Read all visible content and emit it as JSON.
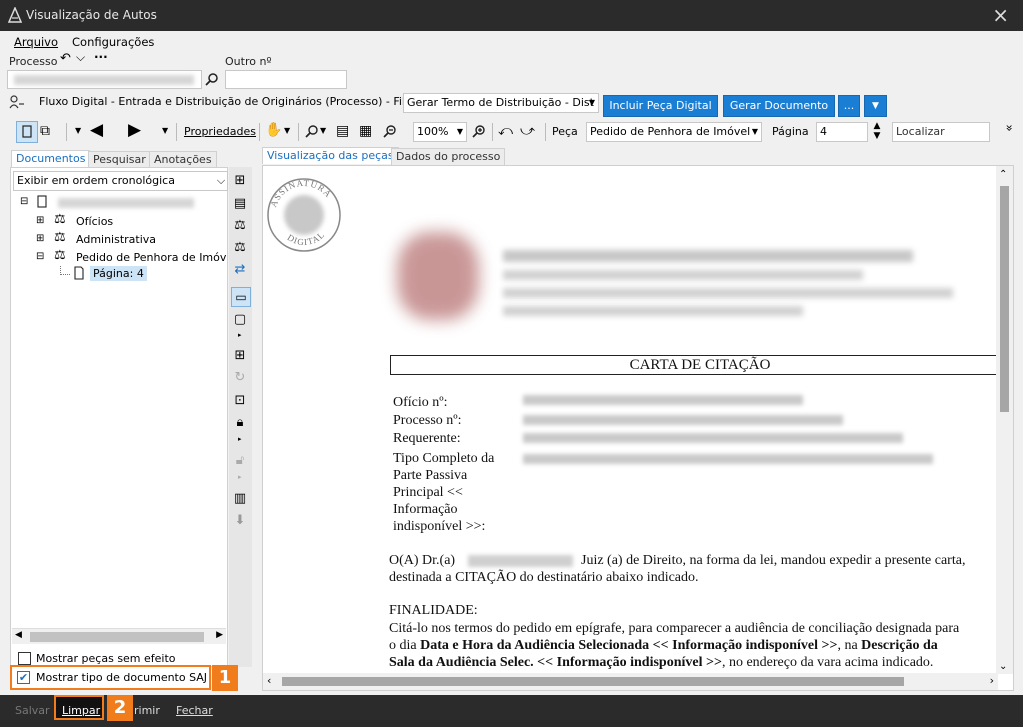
{
  "window": {
    "title": "Visualização de Autos",
    "close_icon": "×"
  },
  "menu": {
    "arquivo": "Arquivo",
    "configuracoes": "Configurações"
  },
  "process": {
    "label": "Processo",
    "other_label": "Outro nº",
    "undo_icon": "↶",
    "dropdown_icon": "⌵",
    "more_icon": "···"
  },
  "fluxo": {
    "text": "Fluxo Digital - Entrada e Distribuição de Originários (Processo) - Fila:",
    "fila_value": "Gerar Termo de Distribuição - Dist",
    "incluir_btn": "Incluir Peça Digital",
    "gerar_btn": "Gerar Documento",
    "more_btn": "...",
    "menu_btn": "▼"
  },
  "toolbar": {
    "propriedades": "Propriedades",
    "zoom": "100%",
    "peca_label": "Peça",
    "peca_value": "Pedido de Penhora de Imóvel",
    "pagina_label": "Página",
    "pagina_value": "4",
    "localizar": "Localizar",
    "overflow_icon": "»"
  },
  "left_panel": {
    "tabs": [
      "Documentos",
      "Pesquisar",
      "Anotações"
    ],
    "order": "Exibir em ordem cronológica",
    "tree": {
      "items": [
        "Ofícios",
        "Administrativa",
        "Pedido de Penhora de Imóvel"
      ],
      "page": "Página: 4"
    },
    "checkbox1": "Mostrar peças sem efeito",
    "checkbox2": "Mostrar tipo de documento SAJ"
  },
  "right_panel": {
    "tabs": [
      "Visualização das peças",
      "Dados do processo"
    ]
  },
  "document": {
    "stamp_top": "ASSINATURA",
    "stamp_bottom": "DIGITAL",
    "heading": "CARTA DE CITAÇÃO",
    "fields": [
      "Ofício nº:",
      "Processo nº:",
      "Requerente:",
      "Tipo Completo da",
      "Parte Passiva",
      "Principal <<",
      "Informação",
      "indisponível >>:"
    ],
    "para1_a": "O(A) Dr.(a)",
    "para1_b": "Juiz (a) de Direito, na forma da lei, mandou expedir a presente carta,",
    "para1_c": "destinada a CITAÇÃO do destinatário abaixo indicado.",
    "finalidade": "FINALIDADE:",
    "fin1": "Citá-lo nos termos do pedido em epígrafe, para comparecer a audiência de conciliação designada para",
    "fin2_a": "o dia ",
    "fin2_b": "Data e Hora da Audiência Selecionada << Informação indisponível >>",
    "fin2_c": ", na ",
    "fin2_d": "Descrição da",
    "fin3_a": "Sala da Audiência Selec. << Informação indisponível >>",
    "fin3_b": ", no endereço da vara acima indicado."
  },
  "footer": {
    "salvar": "Salvar",
    "limpar": "Limpar",
    "imprimir": "rimir",
    "fechar": "Fechar"
  },
  "badges": {
    "one": "1",
    "two": "2"
  },
  "colors": {
    "accent": "#1a7fd4",
    "badge": "#f07c1c",
    "titlebar": "#2b2b2b"
  }
}
